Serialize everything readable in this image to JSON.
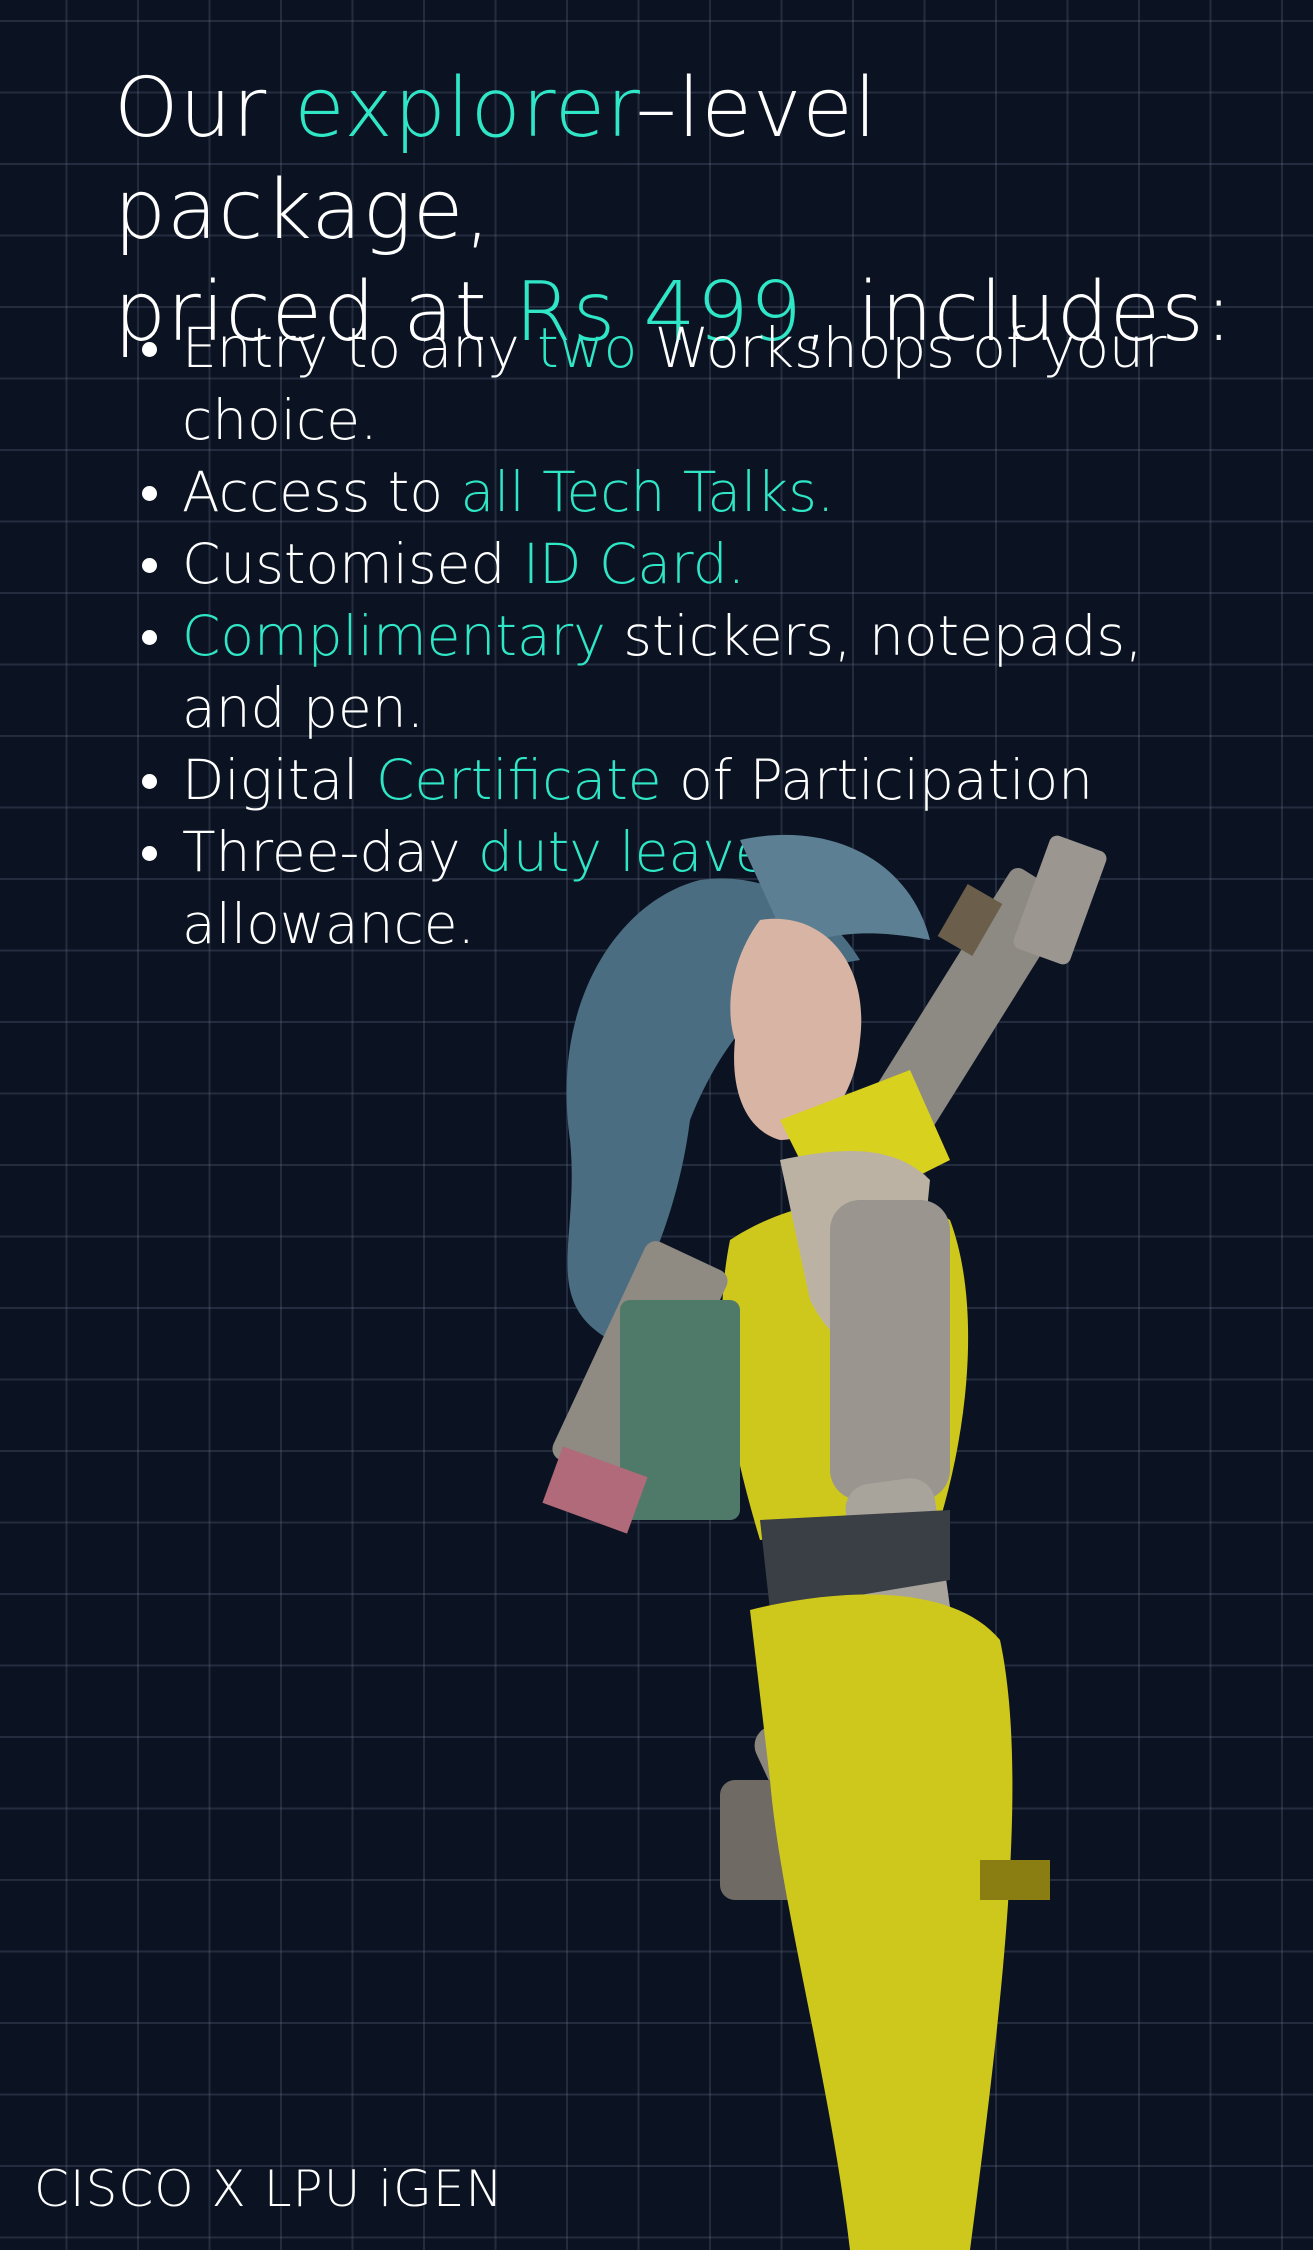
{
  "headline": {
    "part1": "Our ",
    "level": "explorer",
    "part2": "–level package,",
    "part3": "priced at ",
    "price": "Rs 499",
    "part4": ", includes:"
  },
  "benefits": [
    {
      "before": "Entry to any ",
      "highlight": "two",
      "after": " Workshops of your choice."
    },
    {
      "before": "Access to ",
      "highlight": "all Tech Talks.",
      "after": ""
    },
    {
      "before": "Customised ",
      "highlight": "ID Card.",
      "after": ""
    },
    {
      "before": "",
      "highlight": "Complimentary",
      "after": " stickers, notepads, and pen."
    },
    {
      "before": "Digital ",
      "highlight": "Certificate",
      "after": " of Participation"
    },
    {
      "before": "Three-day ",
      "highlight": "duty leave",
      "after": " allowance."
    }
  ],
  "footer": {
    "brand": "CISCO X LPU iGEN"
  },
  "colors": {
    "background": "#0b1322",
    "grid": "#3a4258",
    "accent": "#2fe6c6",
    "text": "#ffffff",
    "suit": "#d8d11e"
  }
}
